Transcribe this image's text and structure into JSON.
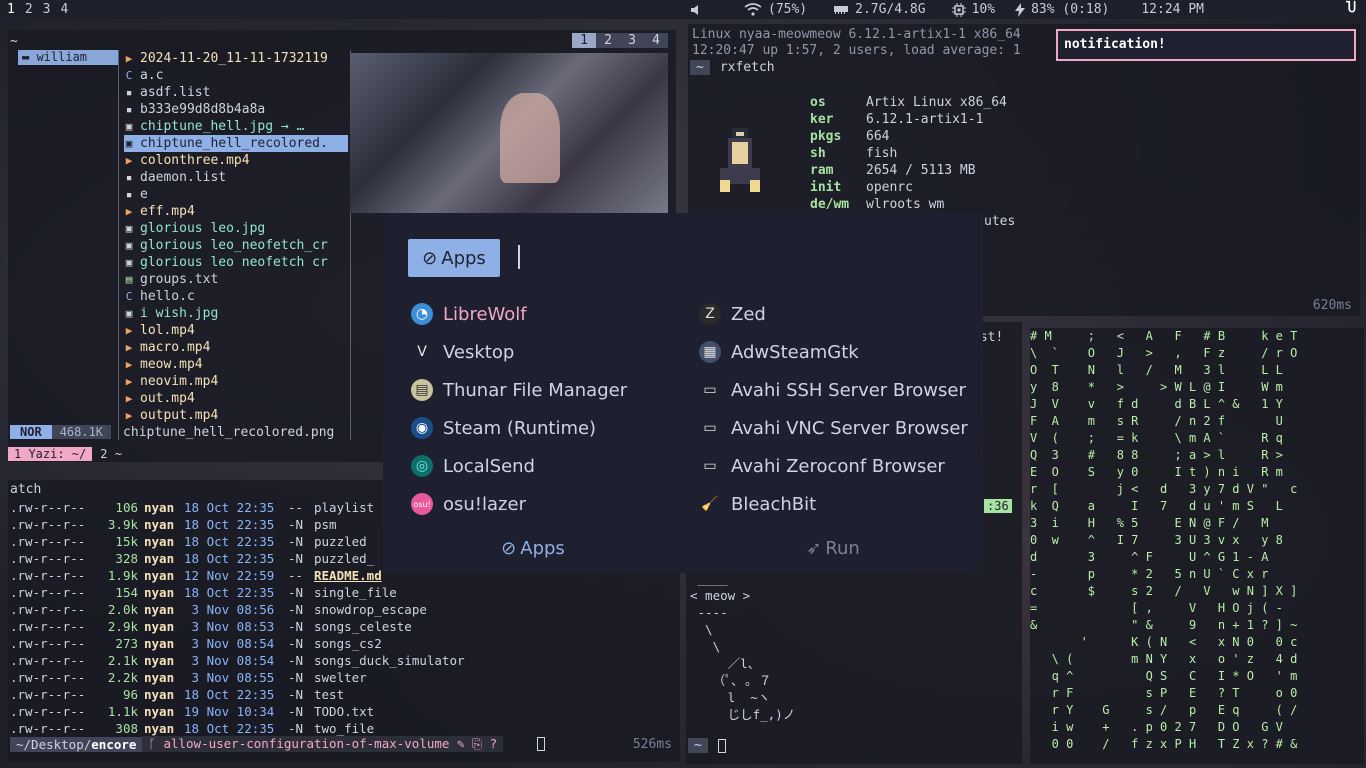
{
  "topbar": {
    "workspaces": [
      "1",
      "2",
      "3",
      "4"
    ],
    "volume_pct": "",
    "wifi": "(75%)",
    "memory": "2.7G/4.8G",
    "cpu": "10%",
    "battery": "83% (0:18)",
    "clock": "12:24 PM"
  },
  "yazi": {
    "cwd": "~",
    "tabs": [
      "1",
      "2",
      "3",
      "4"
    ],
    "parent": "william",
    "files": [
      {
        "icon": "video",
        "name": "2024-11-20_11-11-1732119",
        "color": "#f5e0b8"
      },
      {
        "icon": "c",
        "name": "a.c",
        "color": "#cdd3e0"
      },
      {
        "icon": "file",
        "name": "asdf.list",
        "color": "#cdd3e0"
      },
      {
        "icon": "file",
        "name": "b333e99d8d8b4a8a",
        "color": "#cdd3e0"
      },
      {
        "icon": "image",
        "name": "chiptune_hell.jpg → …",
        "color": "#94e2d5"
      },
      {
        "icon": "image",
        "name": "chiptune_hell_recolored.",
        "color": "#1f2230"
      },
      {
        "icon": "video",
        "name": "colonthree.mp4",
        "color": "#f5e0b8"
      },
      {
        "icon": "file",
        "name": "daemon.list",
        "color": "#cdd3e0"
      },
      {
        "icon": "file",
        "name": "e",
        "color": "#cdd3e0"
      },
      {
        "icon": "video",
        "name": "eff.mp4",
        "color": "#f5e0b8"
      },
      {
        "icon": "image",
        "name": "glorious leo.jpg",
        "color": "#94e2d5"
      },
      {
        "icon": "image",
        "name": "glorious leo_neofetch_cr",
        "color": "#94e2d5"
      },
      {
        "icon": "image",
        "name": "glorious leo neofetch cr",
        "color": "#94e2d5"
      },
      {
        "icon": "text",
        "name": "groups.txt",
        "color": "#cdd3e0"
      },
      {
        "icon": "c",
        "name": "hello.c",
        "color": "#cdd3e0"
      },
      {
        "icon": "image",
        "name": "i wish.jpg",
        "color": "#94e2d5"
      },
      {
        "icon": "video",
        "name": "lol.mp4",
        "color": "#f5e0b8"
      },
      {
        "icon": "video",
        "name": "macro.mp4",
        "color": "#f5e0b8"
      },
      {
        "icon": "video",
        "name": "meow.mp4",
        "color": "#f5e0b8"
      },
      {
        "icon": "video",
        "name": "neovim.mp4",
        "color": "#f5e0b8"
      },
      {
        "icon": "video",
        "name": "out.mp4",
        "color": "#f5e0b8"
      },
      {
        "icon": "video",
        "name": "output.mp4",
        "color": "#f5e0b8"
      }
    ],
    "selected_index": 5,
    "mode": "NOR",
    "size": "468.1K",
    "status_filename": "chiptune_hell_recolored.png",
    "tmux_tab1": "1 Yazi: ~/",
    "tmux_tab2": "2 ~"
  },
  "ls": {
    "head": "atch",
    "rows": [
      {
        "perm": ".rw-r--r--",
        "size": "106",
        "user": "nyan",
        "date": "18 Oct 22:35",
        "git": "--",
        "name": "playlist"
      },
      {
        "perm": ".rw-r--r--",
        "size": "3.9k",
        "user": "nyan",
        "date": "18 Oct 22:35",
        "git": "-N",
        "name": "psm"
      },
      {
        "perm": ".rw-r--r--",
        "size": "15k",
        "user": "nyan",
        "date": "18 Oct 22:35",
        "git": "-N",
        "name": "puzzled"
      },
      {
        "perm": ".rw-r--r--",
        "size": "328",
        "user": "nyan",
        "date": "18 Oct 22:35",
        "git": "-N",
        "name": "puzzled_"
      },
      {
        "perm": ".rw-r--r--",
        "size": "1.9k",
        "user": "nyan",
        "date": "12 Nov 22:59",
        "git": "--",
        "name": "README.md"
      },
      {
        "perm": ".rw-r--r--",
        "size": "154",
        "user": "nyan",
        "date": "18 Oct 22:35",
        "git": "-N",
        "name": "single_file"
      },
      {
        "perm": ".rw-r--r--",
        "size": "2.0k",
        "user": "nyan",
        "date": " 3 Nov 08:56",
        "git": "-N",
        "name": "snowdrop_escape"
      },
      {
        "perm": ".rw-r--r--",
        "size": "2.9k",
        "user": "nyan",
        "date": " 3 Nov 08:53",
        "git": "-N",
        "name": "songs_celeste"
      },
      {
        "perm": ".rw-r--r--",
        "size": "273",
        "user": "nyan",
        "date": " 3 Nov 08:54",
        "git": "-N",
        "name": "songs_cs2"
      },
      {
        "perm": ".rw-r--r--",
        "size": "2.1k",
        "user": "nyan",
        "date": " 3 Nov 08:54",
        "git": "-N",
        "name": "songs_duck_simulator"
      },
      {
        "perm": ".rw-r--r--",
        "size": "2.2k",
        "user": "nyan",
        "date": " 3 Nov 08:55",
        "git": "-N",
        "name": "swelter"
      },
      {
        "perm": ".rw-r--r--",
        "size": "96",
        "user": "nyan",
        "date": "18 Oct 22:35",
        "git": "-N",
        "name": "test"
      },
      {
        "perm": ".rw-r--r--",
        "size": "1.1k",
        "user": "nyan",
        "date": "19 Nov 10:34",
        "git": "-N",
        "name": "TODO.txt"
      },
      {
        "perm": ".rw-r--r--",
        "size": "308",
        "user": "nyan",
        "date": "18 Oct 22:35",
        "git": "-N",
        "name": "two_file"
      }
    ],
    "prompt_dir_prefix": "~/Desktop/",
    "prompt_dir_bold": "encore",
    "branch": "allow-user-configuration-of-max-volume",
    "branch_flags": "?",
    "elapsed": "526ms"
  },
  "rxfetch": {
    "line1": "Linux nyaa-meowmeow 6.12.1-artix1-1 x86_64",
    "line2": " 12:20:47 up  1:57,  2 users,  load average: 1",
    "prompt": "~",
    "command": "rxfetch",
    "fields": [
      {
        "k": "os",
        "v": "Artix Linux x86_64"
      },
      {
        "k": "ker",
        "v": "6.12.1-artix1-1"
      },
      {
        "k": "pkgs",
        "v": "664"
      },
      {
        "k": "sh",
        "v": "fish"
      },
      {
        "k": "ram",
        "v": "2654 / 5113 MB"
      },
      {
        "k": "init",
        "v": "openrc"
      },
      {
        "k": "de/wm",
        "v": "wlroots wm"
      }
    ],
    "partial_tail": "utes",
    "elapsed": "620ms"
  },
  "notification": "notification!",
  "cow": {
    "partial": "ist!",
    "badge": ":36",
    "art": " ____\n< meow >\n ----\n  \\\n   \\\n     ／l、\n   （ﾟ､ ｡ ７\n     l  ~ヽ\n     じしf_,)ノ",
    "prompt": "~"
  },
  "matrix": {
    "text": "# M     ;   <   A   F   # B     k e T\n\\  `    O   J   >   ,   F z     / r O\nO  T    N   l   /   M   3 l     L L\ny  8    *   >     > W L @ I     W m\nJ  V    v   f d     d B L ^ &   1 Y\nF  A    m   s R     / n 2 f       U\nV  (    ;   = k     \\ m A `     R q\nQ  3    #   8 8     ; a > l     R >\nE  O    S   y 0     I t ) n i   R m\nr  [        j <   d   3 y 7 d V \"   c\nk  Q    a     I   7   d u ' m S   L\n3  i    H   % 5     E N @ F /   M\n0  w    ^   I 7     3 U 3 v x   y 8\nd       3     ^ F     U ^ G 1 - A\n-       p     * 2   5 n U ` C x r\nc       $     s 2   /   V   w N ] X ]\n=             [ ,     V   H O j ( -\n&             \" &     9   n + 1 ? ] ~\n       '      K ( N   <   x N 0   0 c\n   \\ (        m N Y   x   o ' z   4 d\n   q ^          Q S   C   I * O   ' m\n   r F          s P   E   ? T     o 0\n   r Y    G     s /   p   E q     ( /\n   i w    +   . p 0 2 7   D O   G V\n   0 0    /   f z x P H   T Z x ? # &"
  },
  "launcher": {
    "mode_label": "Apps",
    "apps_left": [
      {
        "name": "LibreWolf",
        "icon": "librewolf-icon",
        "glyph": "◔",
        "bg": "#3b8fd4",
        "fg": "#fff",
        "hl": true
      },
      {
        "name": "Vesktop",
        "icon": "vesktop-icon",
        "glyph": "V",
        "bg": "transparent",
        "fg": "#e8e8e8",
        "hl": false
      },
      {
        "name": "Thunar File Manager",
        "icon": "thunar-icon",
        "glyph": "▤",
        "bg": "#c8c4a0",
        "fg": "#333",
        "hl": false
      },
      {
        "name": "Steam (Runtime)",
        "icon": "steam-icon",
        "glyph": "◉",
        "bg": "#1b4f8c",
        "fg": "#fff",
        "hl": false
      },
      {
        "name": "LocalSend",
        "icon": "localsend-icon",
        "glyph": "◎",
        "bg": "#0e6e6a",
        "fg": "#6ff0e0",
        "hl": false
      },
      {
        "name": "osu!lazer",
        "icon": "osu-icon",
        "glyph": "osu!",
        "bg": "#e8589a",
        "fg": "#fff",
        "hl": false
      }
    ],
    "apps_right": [
      {
        "name": "Zed",
        "icon": "zed-icon",
        "glyph": "Z",
        "bg": "#2a2a2a",
        "fg": "#ddd",
        "hl": false
      },
      {
        "name": "AdwSteamGtk",
        "icon": "adwsteamgtk-icon",
        "glyph": "▦",
        "bg": "#44506a",
        "fg": "#ddd",
        "hl": false
      },
      {
        "name": "Avahi SSH Server Browser",
        "icon": "avahi-ssh-icon",
        "glyph": "▭",
        "bg": "transparent",
        "fg": "#ddd",
        "hl": false
      },
      {
        "name": "Avahi VNC Server Browser",
        "icon": "avahi-vnc-icon",
        "glyph": "▭",
        "bg": "transparent",
        "fg": "#ddd",
        "hl": false
      },
      {
        "name": "Avahi Zeroconf Browser",
        "icon": "avahi-zeroconf-icon",
        "glyph": "▭",
        "bg": "transparent",
        "fg": "#ddd",
        "hl": false
      },
      {
        "name": "BleachBit",
        "icon": "bleachbit-icon",
        "glyph": "🧹",
        "bg": "transparent",
        "fg": "#f0a040",
        "hl": false
      }
    ],
    "tab_apps": "Apps",
    "tab_run": "Run"
  }
}
